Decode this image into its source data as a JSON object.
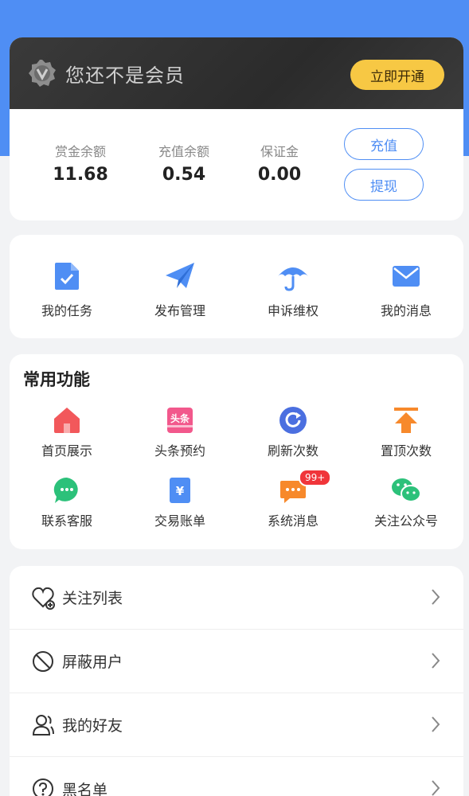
{
  "member": {
    "status_text": "您还不是会员",
    "open_button": "立即开通"
  },
  "balances": [
    {
      "label": "赏金余额",
      "value": "11.68"
    },
    {
      "label": "充值余额",
      "value": "0.54"
    },
    {
      "label": "保证金",
      "value": "0.00"
    }
  ],
  "actions": {
    "recharge": "充值",
    "withdraw": "提现"
  },
  "quick": [
    {
      "label": "我的任务",
      "icon": "task-doc-icon"
    },
    {
      "label": "发布管理",
      "icon": "paper-plane-icon"
    },
    {
      "label": "申诉维权",
      "icon": "umbrella-icon"
    },
    {
      "label": "我的消息",
      "icon": "mail-icon"
    }
  ],
  "functions": {
    "title": "常用功能",
    "items": [
      {
        "label": "首页展示",
        "icon": "home-icon"
      },
      {
        "label": "头条预约",
        "icon": "headline-icon",
        "icon_text": "头条"
      },
      {
        "label": "刷新次数",
        "icon": "refresh-icon"
      },
      {
        "label": "置顶次数",
        "icon": "pin-top-icon"
      },
      {
        "label": "联系客服",
        "icon": "chat-bubble-icon"
      },
      {
        "label": "交易账单",
        "icon": "bill-icon",
        "icon_text": "¥"
      },
      {
        "label": "系统消息",
        "icon": "message-icon",
        "badge": "99+"
      },
      {
        "label": "关注公众号",
        "icon": "wechat-icon"
      }
    ]
  },
  "menu": [
    {
      "label": "关注列表",
      "icon": "heart-plus-icon"
    },
    {
      "label": "屏蔽用户",
      "icon": "block-icon"
    },
    {
      "label": "我的好友",
      "icon": "friends-icon"
    },
    {
      "label": "黑名单",
      "icon": "question-icon"
    }
  ],
  "colors": {
    "primary": "#4f8ef4",
    "gold": "#f7c844",
    "badge_red": "#f0353a"
  }
}
